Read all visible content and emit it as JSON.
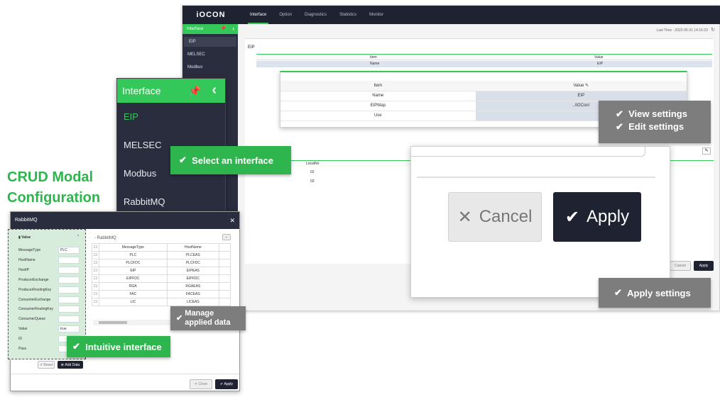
{
  "headline": "CRUD Modal\nConfiguration",
  "app": {
    "logo": "iOCON",
    "nav": [
      "Interface",
      "Option",
      "Diagnostics",
      "Statistics",
      "Monitor"
    ],
    "sidebar_title": "Interface",
    "sidebar_items": [
      "EIP",
      "MELSEC",
      "Modbus"
    ],
    "last_time": "Last Time : 2022-05-31 14:16:33",
    "section_label": "EIP",
    "table": {
      "col_item": "Item",
      "col_value": "Value",
      "row_name": "Name",
      "row_value": "EIP"
    },
    "lower_table": {
      "header": "LocalNo",
      "rows": [
        "02",
        "03"
      ]
    },
    "cancel": "Cancel",
    "apply": "Apply"
  },
  "detail_card": {
    "col_item": "Item",
    "col_value": "Value",
    "rows": [
      {
        "item": "Name",
        "value": "EIP"
      },
      {
        "item": "EIPMap",
        "value": "../IOCon/"
      },
      {
        "item": "Use",
        "value": ""
      }
    ]
  },
  "zoom": {
    "cancel": "Cancel",
    "apply": "Apply"
  },
  "interface_panel": {
    "title": "Interface",
    "items": [
      "EIP",
      "MELSEC",
      "Modbus",
      "RabbitMQ"
    ]
  },
  "callouts": {
    "select": "Select an interface",
    "view": "View settings",
    "edit": "Edit settings",
    "apply": "Apply settings",
    "manage_1": "Manage",
    "manage_2": "applied data",
    "intuitive": "Intuitive interface"
  },
  "modal": {
    "title": "RabbitMQ",
    "value_label": "Value",
    "fields": [
      {
        "label": "MessageType",
        "value": "PLC"
      },
      {
        "label": "HostName",
        "value": ""
      },
      {
        "label": "HostIP",
        "value": ""
      },
      {
        "label": "ProducerExchange",
        "value": ""
      },
      {
        "label": "ProducerRoutingKey",
        "value": ""
      },
      {
        "label": "ConsumerExchange",
        "value": ""
      },
      {
        "label": "ConsumerRoutingKey",
        "value": ""
      },
      {
        "label": "ConsumerQueue",
        "value": ""
      },
      {
        "label": "Value",
        "value": "true"
      },
      {
        "label": "ID",
        "value": ""
      },
      {
        "label": "Pass",
        "value": ""
      }
    ],
    "list_title": "- RabbitMQ",
    "col_type": "MessageType",
    "col_host": "HostName",
    "rows": [
      {
        "type": "PLC",
        "host": "PLCEAS"
      },
      {
        "type": "PLCFDC",
        "host": "PLCFDC"
      },
      {
        "type": "EIP",
        "host": "EIPEAS"
      },
      {
        "type": "EIPFDC",
        "host": "EIPFDC"
      },
      {
        "type": "RGA",
        "host": "RGAEAS"
      },
      {
        "type": "FAC",
        "host": "FACEAS"
      },
      {
        "type": "LIC",
        "host": "LICEAS"
      }
    ],
    "reset": "Reset",
    "add_data": "Add Data",
    "close": "Close",
    "apply": "Apply"
  },
  "colors": {
    "accent": "#34c759",
    "dark": "#1f2230",
    "callout_green": "#2fb54e",
    "callout_gray": "#7d7d7d"
  }
}
